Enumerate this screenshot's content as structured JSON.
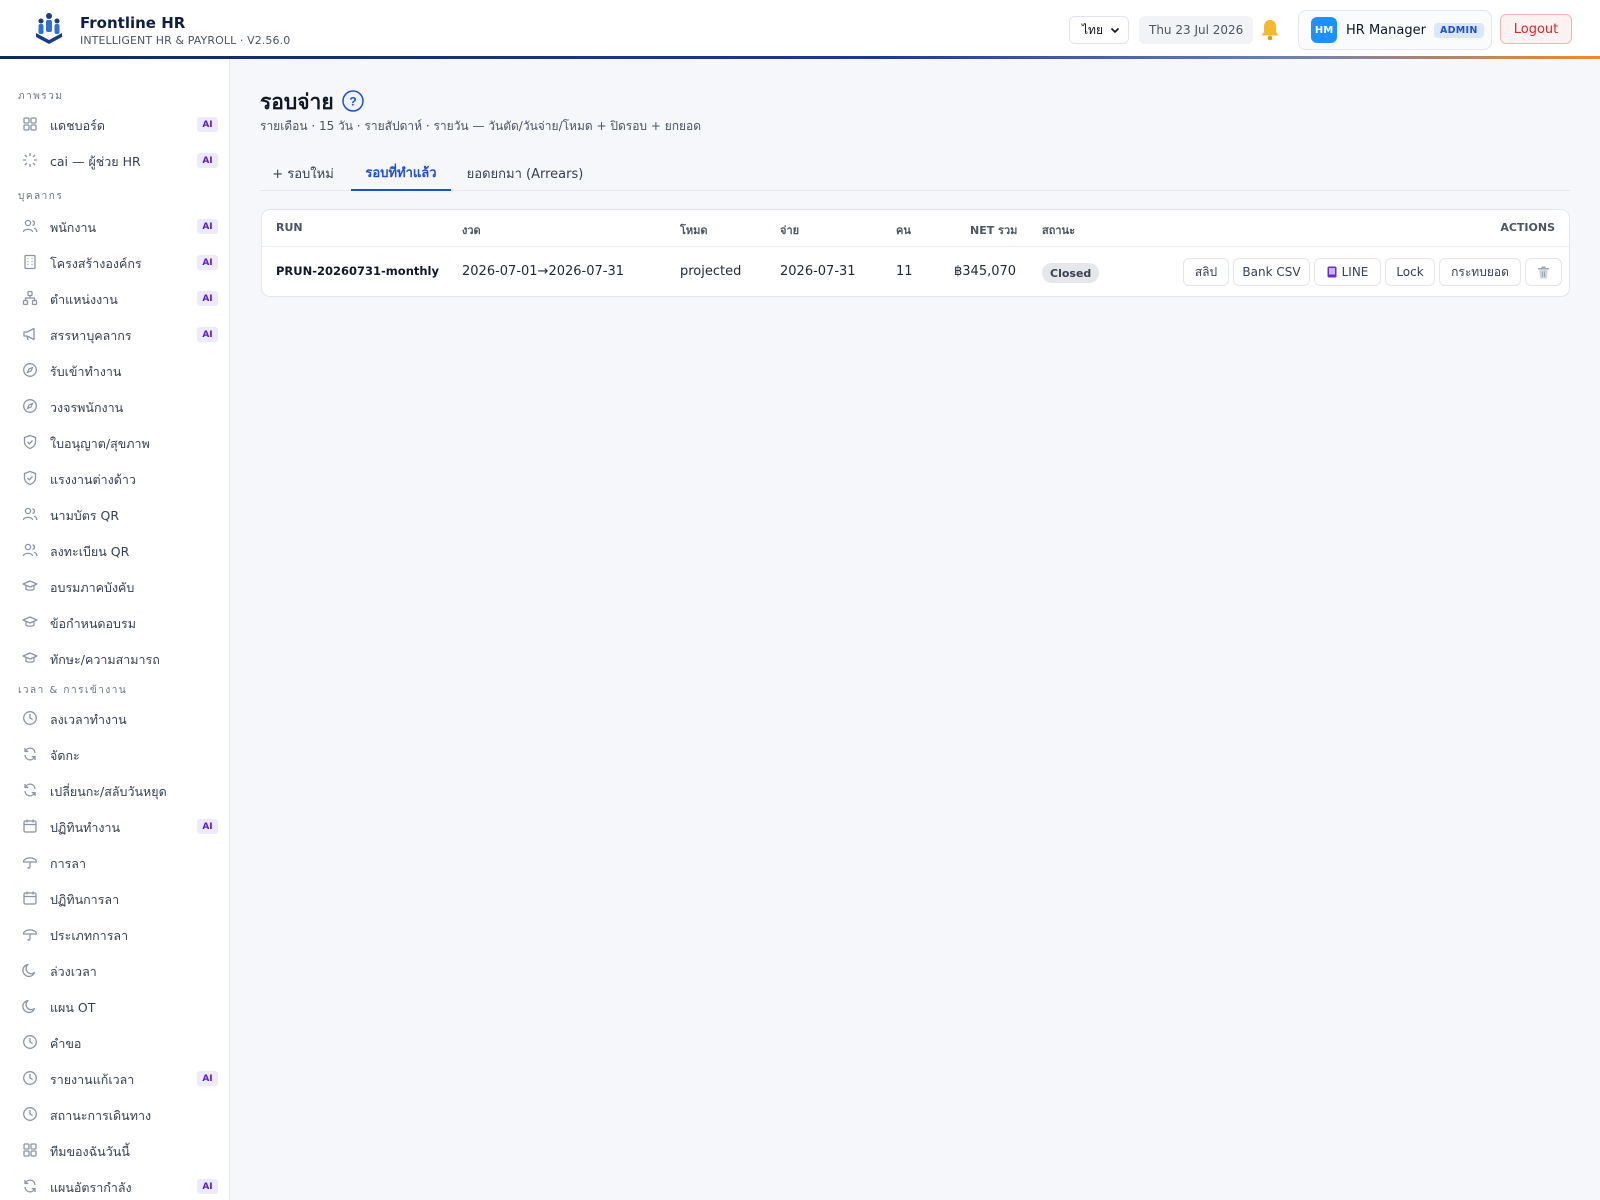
{
  "brand": {
    "title": "Frontline HR",
    "subtitle": "INTELLIGENT HR & PAYROLL · V2.56.0"
  },
  "header": {
    "language": "ไทย",
    "date": "Thu 23 Jul 2026",
    "user_initials": "HM",
    "user_name": "HR Manager",
    "role": "ADMIN",
    "logout_label": "Logout"
  },
  "sidebar": {
    "sections": [
      {
        "label": "ภาพรวม"
      },
      {
        "label": "บุคลากร"
      },
      {
        "label": "เวลา & การเข้างาน"
      }
    ],
    "items": [
      {
        "label": "แดชบอร์ด",
        "icon": "grid-icon",
        "ai": "AI"
      },
      {
        "label": "cai — ผู้ช่วย HR",
        "icon": "sparkle-icon",
        "ai": "AI"
      },
      {
        "label": "พนักงาน",
        "icon": "users-icon",
        "ai": "AI"
      },
      {
        "label": "โครงสร้างองค์กร",
        "icon": "building-icon",
        "ai": "AI"
      },
      {
        "label": "ตำแหน่งงาน",
        "icon": "org-chart-icon",
        "ai": "AI"
      },
      {
        "label": "สรรหาบุคลากร",
        "icon": "megaphone-icon",
        "ai": "AI"
      },
      {
        "label": "รับเข้าทำงาน",
        "icon": "compass-icon",
        "ai": ""
      },
      {
        "label": "วงจรพนักงาน",
        "icon": "compass-icon",
        "ai": ""
      },
      {
        "label": "ใบอนุญาต/สุขภาพ",
        "icon": "shield-icon",
        "ai": ""
      },
      {
        "label": "แรงงานต่างด้าว",
        "icon": "shield-icon",
        "ai": ""
      },
      {
        "label": "นามบัตร QR",
        "icon": "users-icon",
        "ai": ""
      },
      {
        "label": "ลงทะเบียน QR",
        "icon": "users-icon",
        "ai": ""
      },
      {
        "label": "อบรมภาคบังคับ",
        "icon": "graduation-cap-icon",
        "ai": ""
      },
      {
        "label": "ข้อกำหนดอบรม",
        "icon": "graduation-cap-icon",
        "ai": ""
      },
      {
        "label": "ทักษะ/ความสามารถ",
        "icon": "graduation-cap-icon",
        "ai": ""
      },
      {
        "label": "ลงเวลาทำงาน",
        "icon": "clock-icon",
        "ai": ""
      },
      {
        "label": "จัดกะ",
        "icon": "refresh-icon",
        "ai": ""
      },
      {
        "label": "เปลี่ยนกะ/สลับวันหยุด",
        "icon": "refresh-icon",
        "ai": ""
      },
      {
        "label": "ปฏิทินทำงาน",
        "icon": "calendar-icon",
        "ai": "AI"
      },
      {
        "label": "การลา",
        "icon": "umbrella-icon",
        "ai": ""
      },
      {
        "label": "ปฏิทินการลา",
        "icon": "calendar-icon",
        "ai": ""
      },
      {
        "label": "ประเภทการลา",
        "icon": "umbrella-icon",
        "ai": ""
      },
      {
        "label": "ล่วงเวลา",
        "icon": "moon-icon",
        "ai": ""
      },
      {
        "label": "แผน OT",
        "icon": "moon-icon",
        "ai": ""
      },
      {
        "label": "คำขอ",
        "icon": "clock-icon",
        "ai": ""
      },
      {
        "label": "รายงานแก้เวลา",
        "icon": "clock-icon",
        "ai": "AI"
      },
      {
        "label": "สถานะการเดินทาง",
        "icon": "clock-icon",
        "ai": ""
      },
      {
        "label": "ทีมของฉันวันนี้",
        "icon": "grid-icon",
        "ai": ""
      },
      {
        "label": "แผนอัตรากำลัง",
        "icon": "refresh-icon",
        "ai": "AI"
      }
    ]
  },
  "main": {
    "title": "รอบจ่าย",
    "help": "?",
    "subtitle": "รายเดือน · 15 วัน · รายสัปดาห์ · รายวัน — วันตัด/วันจ่าย/โหมด + ปิดรอบ + ยกยอด",
    "tabs": [
      {
        "label": "+ รอบใหม่"
      },
      {
        "label": "รอบที่ทำแล้ว"
      },
      {
        "label": "ยอดยกมา (Arrears)"
      }
    ],
    "active_tab": 1,
    "table": {
      "columns": [
        "RUN",
        "งวด",
        "โหมด",
        "จ่าย",
        "คน",
        "NET รวม",
        "สถานะ",
        "ACTIONS"
      ],
      "rows": [
        {
          "run": "PRUN-20260731-monthly",
          "period": "2026-07-01→2026-07-31",
          "mode": "projected",
          "pay_date": "2026-07-31",
          "people": "11",
          "net": "฿345,070",
          "status": "Closed"
        }
      ],
      "actions": {
        "slip": "สลิป",
        "bank_csv": "Bank CSV",
        "line": "LINE",
        "lock": "Lock",
        "carry": "กระทบยอด"
      }
    }
  },
  "colors": {
    "accent": "#1d4ed8",
    "logout": "#dc2626",
    "ai_badge": "#5b21b6",
    "avatar": "#1e90ff"
  }
}
